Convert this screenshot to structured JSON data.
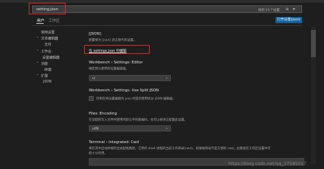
{
  "search": {
    "value": "setting.json",
    "results": "找到 15 个设置"
  },
  "tabs": {
    "user": "用户",
    "workspace": "工作区"
  },
  "open_json_button": "打开设置(json)",
  "toc": [
    {
      "label": "常用设置",
      "arrow": ""
    },
    {
      "label": "文本编辑器",
      "arrow": "⌄"
    },
    {
      "label": "文件",
      "arrow": ""
    },
    {
      "label": "工作台",
      "arrow": "⌄"
    },
    {
      "label": "设置编辑器",
      "arrow": ""
    },
    {
      "label": "功能",
      "arrow": "⌄"
    },
    {
      "label": "终端",
      "arrow": ""
    },
    {
      "label": "扩展",
      "arrow": "⌄"
    },
    {
      "label": "JSON",
      "arrow": ""
    }
  ],
  "settings": {
    "json": {
      "title": "[JSON]",
      "desc": "配置要为 [json] 语言替代的设置。",
      "link": "在 settings.json 中编辑"
    },
    "editor": {
      "title": "Workbench › Settings: Editor",
      "desc": "确定默认使用的设置编辑器。",
      "value": "ui"
    },
    "split_json": {
      "title": "Workbench › Settings: Use Split JSON",
      "desc": "控制在将设置编辑为 json 时是否使用拆分 JSON 编辑器。"
    },
    "encoding": {
      "title": "Files: Encoding",
      "desc": "在读取和写入文件时使用的默认字符集编码。也可以按语言配置此设置。",
      "value": "utf8"
    },
    "cwd": {
      "title": "Terminal › Integrated: Cwd",
      "desc1": "将在其中启动终端的显式起始路径，它用作 shell 进程的当前工作目录(cwd)。如果根目录不是方便的 cwd，此路径在工作区设置中可",
      "desc2": "能十分有用。"
    }
  },
  "watermark": "https://blog.csdn.net/qq_37585017"
}
